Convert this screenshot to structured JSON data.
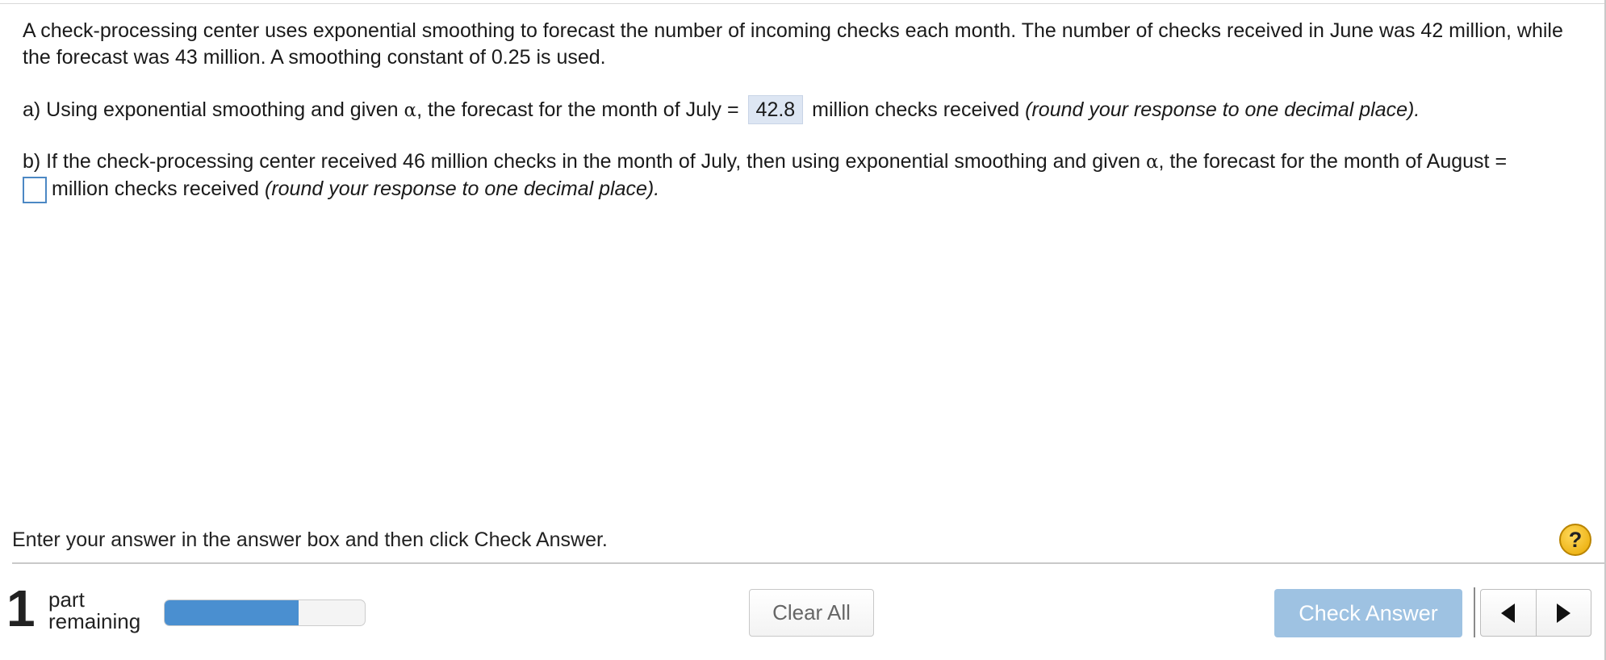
{
  "question": {
    "intro": "A check-processing center uses exponential smoothing to forecast the number of incoming checks each month. The number of checks received in June was 42 million, while the forecast was 43 million. A smoothing constant of 0.25 is used.",
    "part_a": {
      "prefix": "a) Using exponential smoothing and given ",
      "alpha": "α",
      "middle": ", the forecast for the month of July = ",
      "answer": "42.8",
      "suffix": " million checks received ",
      "note": "(round your response to one decimal place)."
    },
    "part_b": {
      "prefix": "b) If the check-processing center received 46 million checks in the month of July, then using exponential smoothing and given ",
      "alpha": "α",
      "middle": ", the forecast for the month of August = ",
      "answer": "",
      "suffix": "million checks received ",
      "note": "(round your response to one decimal place)."
    }
  },
  "instructions": "Enter your answer in the answer box and then click Check Answer.",
  "help_label": "?",
  "footer": {
    "parts_remaining": "1",
    "parts_label_line1": "part",
    "parts_label_line2": "remaining",
    "progress_percent": 67,
    "clear_label": "Clear All",
    "check_label": "Check Answer"
  }
}
